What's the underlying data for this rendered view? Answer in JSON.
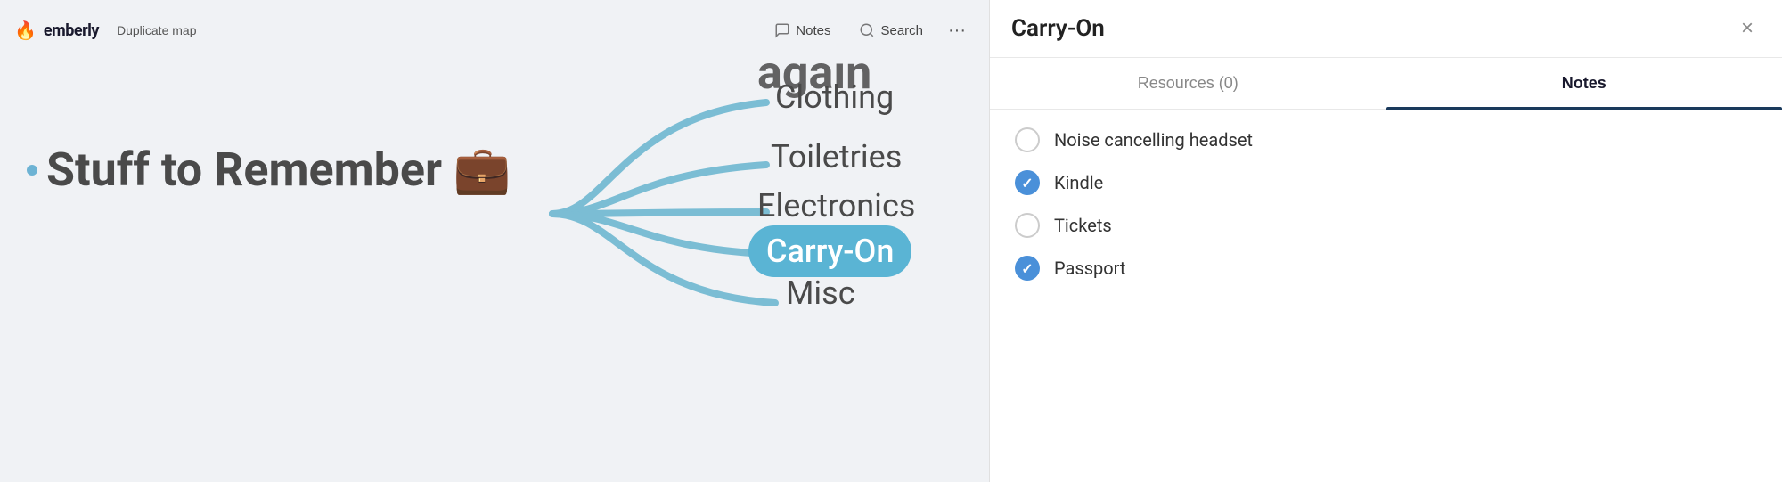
{
  "app": {
    "logo_text": "emberly",
    "logo_icon": "🔥",
    "duplicate_map_label": "Duplicate map"
  },
  "topbar": {
    "notes_label": "Notes",
    "search_label": "Search",
    "more_icon": "•••"
  },
  "mindmap": {
    "central_node_text": "Stuff to Remember 💼",
    "top_partial_text": "prime time again",
    "branches": [
      {
        "label": "Clothing",
        "class": "clothing"
      },
      {
        "label": "Toiletries",
        "class": "toiletries"
      },
      {
        "label": "Electronics",
        "class": "electronics"
      },
      {
        "label": "Carry-On",
        "class": "carry-on"
      },
      {
        "label": "Misc",
        "class": "misc"
      }
    ]
  },
  "panel": {
    "title": "Carry-On",
    "close_icon": "×",
    "tabs": [
      {
        "label": "Resources (0)",
        "active": false
      },
      {
        "label": "Notes",
        "active": true
      }
    ],
    "notes_heading": "Notes",
    "checklist": [
      {
        "text": "Noise cancelling headset",
        "checked": false
      },
      {
        "text": "Kindle",
        "checked": true
      },
      {
        "text": "Tickets",
        "checked": false
      },
      {
        "text": "Passport",
        "checked": true
      }
    ]
  }
}
